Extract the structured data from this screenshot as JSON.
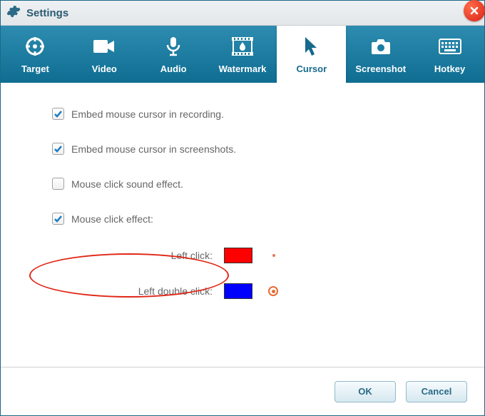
{
  "window": {
    "title": "Settings"
  },
  "tabs": [
    {
      "label": "Target"
    },
    {
      "label": "Video"
    },
    {
      "label": "Audio"
    },
    {
      "label": "Watermark"
    },
    {
      "label": "Cursor"
    },
    {
      "label": "Screenshot"
    },
    {
      "label": "Hotkey"
    }
  ],
  "activeTab": "Cursor",
  "options": {
    "embedCursorRecording": {
      "label": "Embed mouse cursor in recording.",
      "checked": true
    },
    "embedCursorScreenshots": {
      "label": "Embed mouse cursor in screenshots.",
      "checked": true
    },
    "clickSound": {
      "label": "Mouse click sound effect.",
      "checked": false
    },
    "clickEffect": {
      "label": "Mouse click effect:",
      "checked": true
    }
  },
  "clickColors": {
    "left": {
      "label": "Left click:",
      "color": "#ff0000"
    },
    "leftDouble": {
      "label": "Left double click:",
      "color": "#0000ff"
    }
  },
  "buttons": {
    "ok": "OK",
    "cancel": "Cancel"
  }
}
